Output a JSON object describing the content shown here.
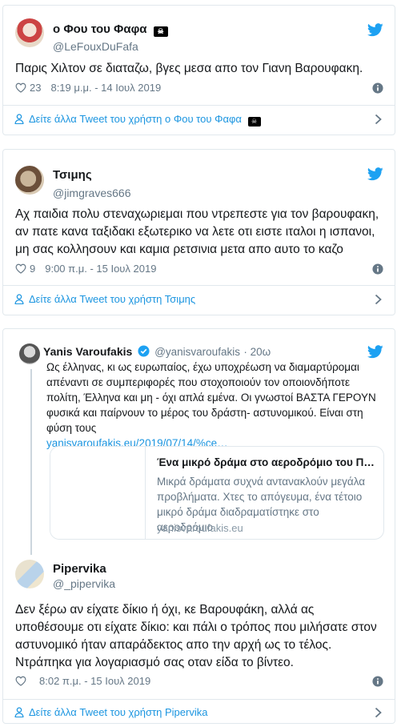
{
  "colors": {
    "link": "#1b95e0",
    "muted": "#657786",
    "border": "#e1e8ed",
    "twitter_blue": "#1da1f2"
  },
  "tweets": [
    {
      "name": "ο Φου του Φαφα",
      "handle": "@LeFouxDuFafa",
      "text": "Παρις Χιλτον σε διαταζω, βγες μεσα απο τον Γιανη Βαρουφακη.",
      "likes": "23",
      "time": "8:19 μ.μ. - 14 Ιουλ 2019",
      "more": "Δείτε άλλα Tweet του χρήστη ο Φου του Φαφα"
    },
    {
      "name": "Τσιμης",
      "handle": "@jimgraves666",
      "text": "Αχ παιδια πολυ στεναχωριεμαι που ντρεπεστε για τον βαρουφακη, αν πατε κανα ταξιδακι εξωτερικο να λετε οτι ειστε ιταλοι η ισπανοι, μη σας κολλησουν και καμια ρετσινια μετα απο αυτο το καζο",
      "likes": "9",
      "time": "9:00 π.μ. - 15 Ιουλ 2019",
      "more": "Δείτε άλλα Tweet του χρήστη Τσιμης"
    }
  ],
  "quoted": {
    "name": "Yanis Varoufakis",
    "handle": "@yanisvaroufakis",
    "age": "· 20ω",
    "text": "Ως έλληνας, κι ως ευρωπαίος, έχω υποχρέωση να διαμαρτύρομαι απέναντι σε συμπεριφορές που στοχοποιούν τον οποιονδήποτε πολίτη, Έλληνα και μη - όχι απλά εμένα. Οι γνωστοί ΒΑΣΤΑ ΓΕΡΟΥΝ φυσικά και παίρνουν το μέρος του δράστη- αστυνομικού. Είναι στη φύση τους",
    "link": "yanisvaroufakis.eu/2019/07/14/%ce…",
    "card_title": "Ένα μικρό δράμα στο αεροδρόμιο του Π…",
    "card_desc": "Μικρά δράματα συχνά αντανακλούν μεγάλα προβλήματα. Χτες το απόγευμα, ένα τέτοιο μικρό δράμα διαδραματίστηκε στο αεροδρόμιο",
    "card_domain": "yanisvaroufakis.eu"
  },
  "reply": {
    "name": "Pipervika",
    "handle": "@_pipervika",
    "text": "Δεν ξέρω αν είχατε δίκιο ή όχι, κε Βαρουφάκη, αλλά ας υποθέσουμε οτι είχατε δίκιο: και πάλι ο τρόπος που μιλήσατε στον αστυνομικό ήταν απαράδεκτος απο την αρχή ως το τέλος. Ντράπηκα για λογαριασμό σας οταν είδα το βίντεο.",
    "time": "8:02 π.μ. - 15 Ιουλ 2019",
    "more": "Δείτε άλλα Tweet του χρήστη Pipervika"
  },
  "icons": [
    "heart-icon",
    "info-icon",
    "person-icon",
    "chevron-right-icon",
    "twitter-bird-icon",
    "verified-icon",
    "pirate-flag-icon"
  ]
}
